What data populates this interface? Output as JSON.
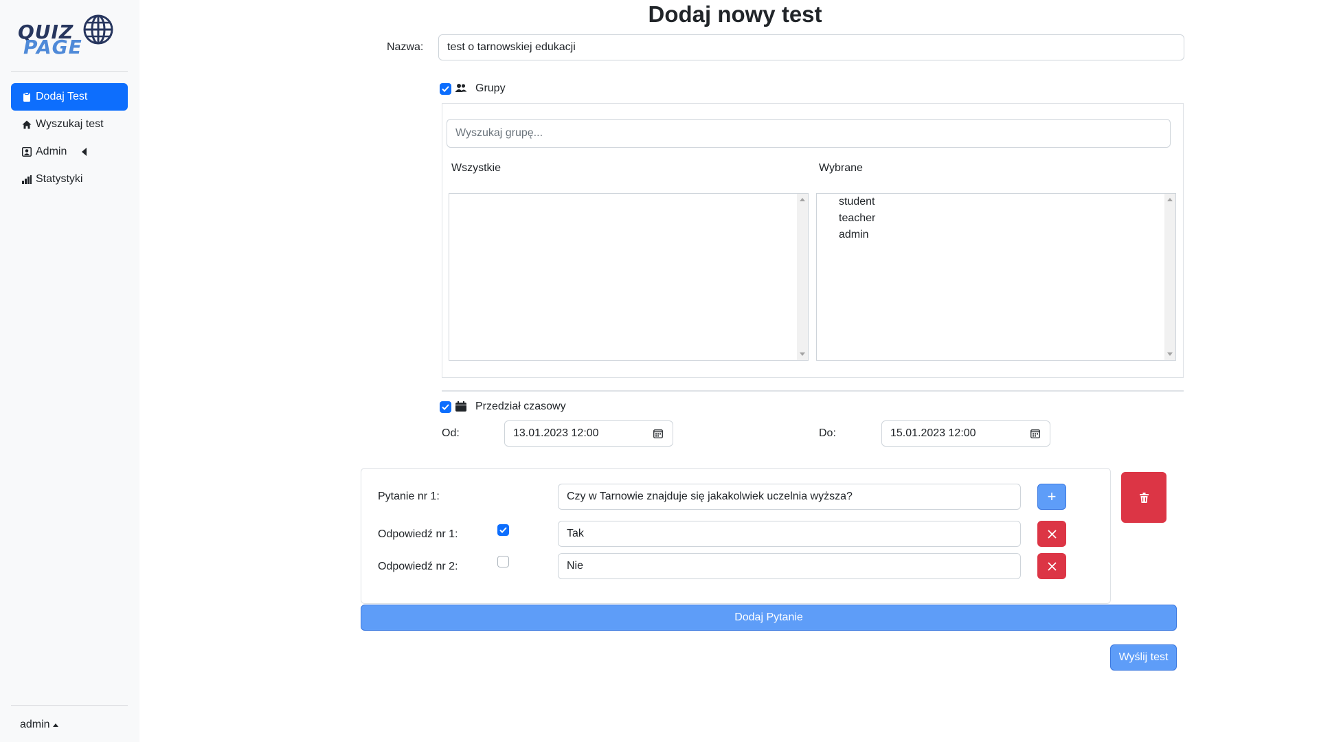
{
  "sidebar": {
    "logo": {
      "line1": "QUIZ",
      "line2": "PAGE",
      "icon": "globe-icon"
    },
    "items": [
      {
        "label": "Dodaj Test",
        "icon": "clipboard-icon",
        "active": true
      },
      {
        "label": "Wyszukaj test",
        "icon": "house-icon",
        "active": false
      },
      {
        "label": "Admin",
        "icon": "person-badge-icon",
        "active": false
      },
      {
        "label": "Statystyki",
        "icon": "bar-chart-icon",
        "active": false
      }
    ],
    "user": "admin"
  },
  "page": {
    "title": "Dodaj nowy test",
    "name_label": "Nazwa:",
    "name_value": "test o tarnowskiej edukacji"
  },
  "groups": {
    "checkbox_label": "Grupy",
    "checked": true,
    "search_placeholder": "Wyszukaj grupę...",
    "all_label": "Wszystkie",
    "selected_label": "Wybrane",
    "all_items": [],
    "selected_items": [
      "student",
      "teacher",
      "admin"
    ]
  },
  "time": {
    "checkbox_label": "Przedział czasowy",
    "checked": true,
    "from_label": "Od:",
    "from_value": "13.01.2023 12:00",
    "to_label": "Do:",
    "to_value": "15.01.2023 12:00"
  },
  "question": {
    "label": "Pytanie nr 1:",
    "value": "Czy w Tarnowie znajduje się jakakolwiek uczelnia wyższa?",
    "answers": [
      {
        "label": "Odpowiedź nr 1:",
        "value": "Tak",
        "correct": true
      },
      {
        "label": "Odpowiedź nr 2:",
        "value": "Nie",
        "correct": false
      }
    ]
  },
  "buttons": {
    "add_question": "Dodaj Pytanie",
    "send": "Wyślij test",
    "add_answer": "+"
  },
  "colors": {
    "primary": "#0d6efd",
    "danger": "#dc3545",
    "light_primary": "#5e9df8"
  }
}
